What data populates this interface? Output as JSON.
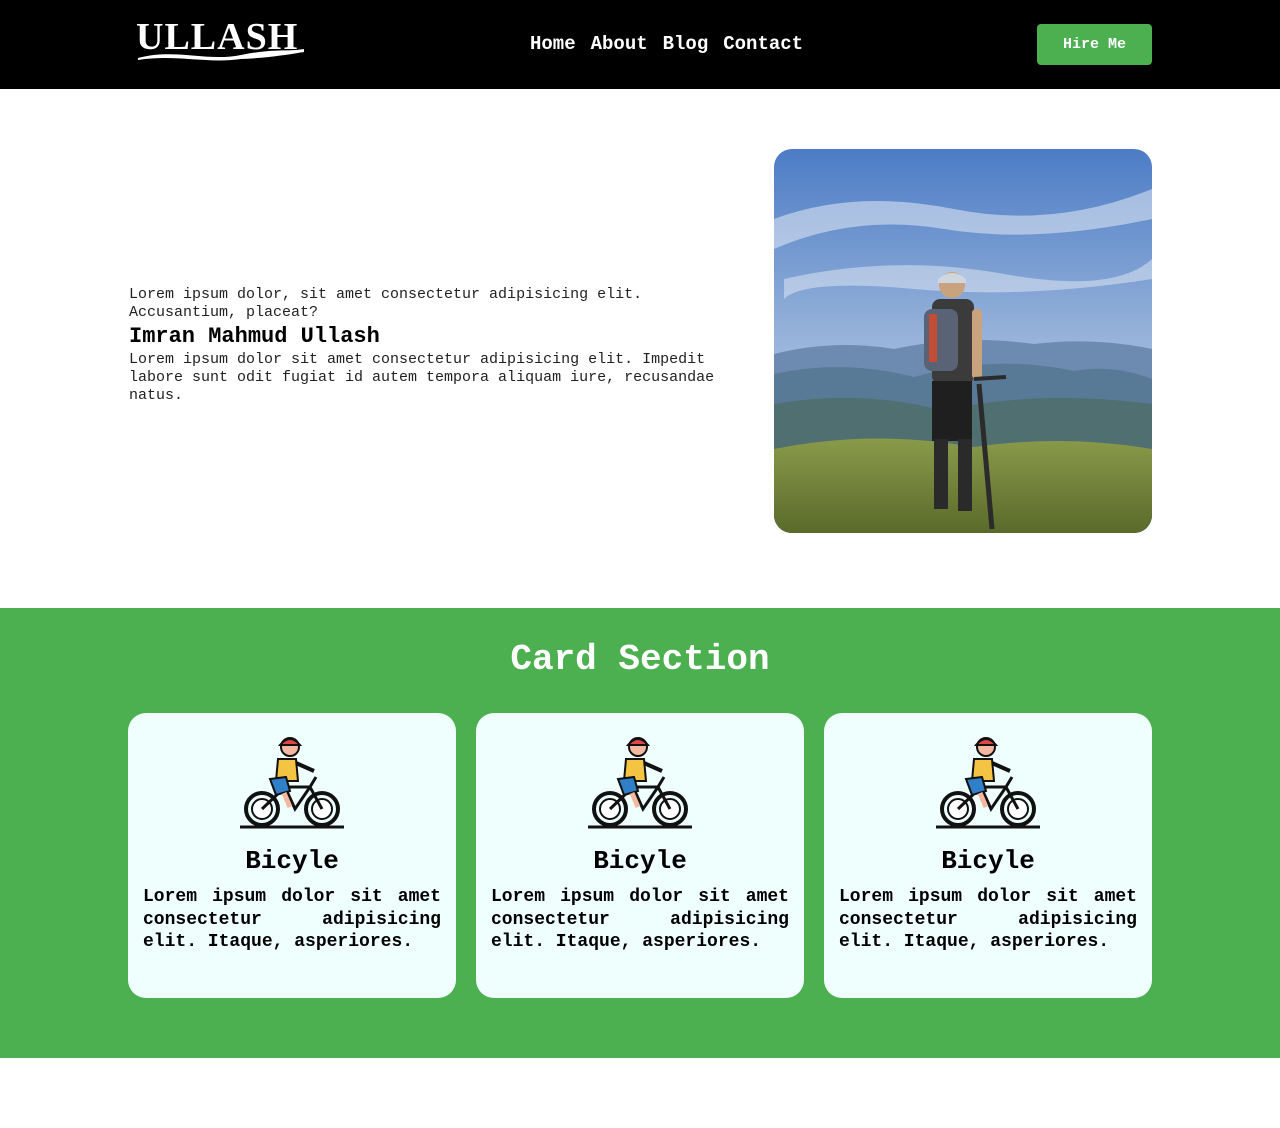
{
  "header": {
    "logo_text": "ULLASH",
    "nav": [
      "Home",
      "About",
      "Blog",
      "Contact"
    ],
    "cta_label": "Hire Me"
  },
  "hero": {
    "intro": "Lorem ipsum dolor, sit amet consectetur adipisicing elit. Accusantium, placeat?",
    "name": "Imran Mahmud Ullash",
    "description": "Lorem ipsum dolor sit amet consectetur adipisicing elit. Impedit labore sunt odit fugiat id autem tempora aliquam iure, recusandae natus."
  },
  "cards_section": {
    "title": "Card Section",
    "cards": [
      {
        "icon": "cyclist-icon",
        "title": "Bicyle",
        "text": "Lorem ipsum dolor sit amet consectetur adipisicing elit. Itaque, asperiores."
      },
      {
        "icon": "cyclist-icon",
        "title": "Bicyle",
        "text": "Lorem ipsum dolor sit amet consectetur adipisicing elit. Itaque, asperiores."
      },
      {
        "icon": "cyclist-icon",
        "title": "Bicyle",
        "text": "Lorem ipsum dolor sit amet consectetur adipisicing elit. Itaque, asperiores."
      }
    ]
  },
  "colors": {
    "header_bg": "#000000",
    "accent": "#4caf50",
    "card_bg": "#effffe"
  }
}
